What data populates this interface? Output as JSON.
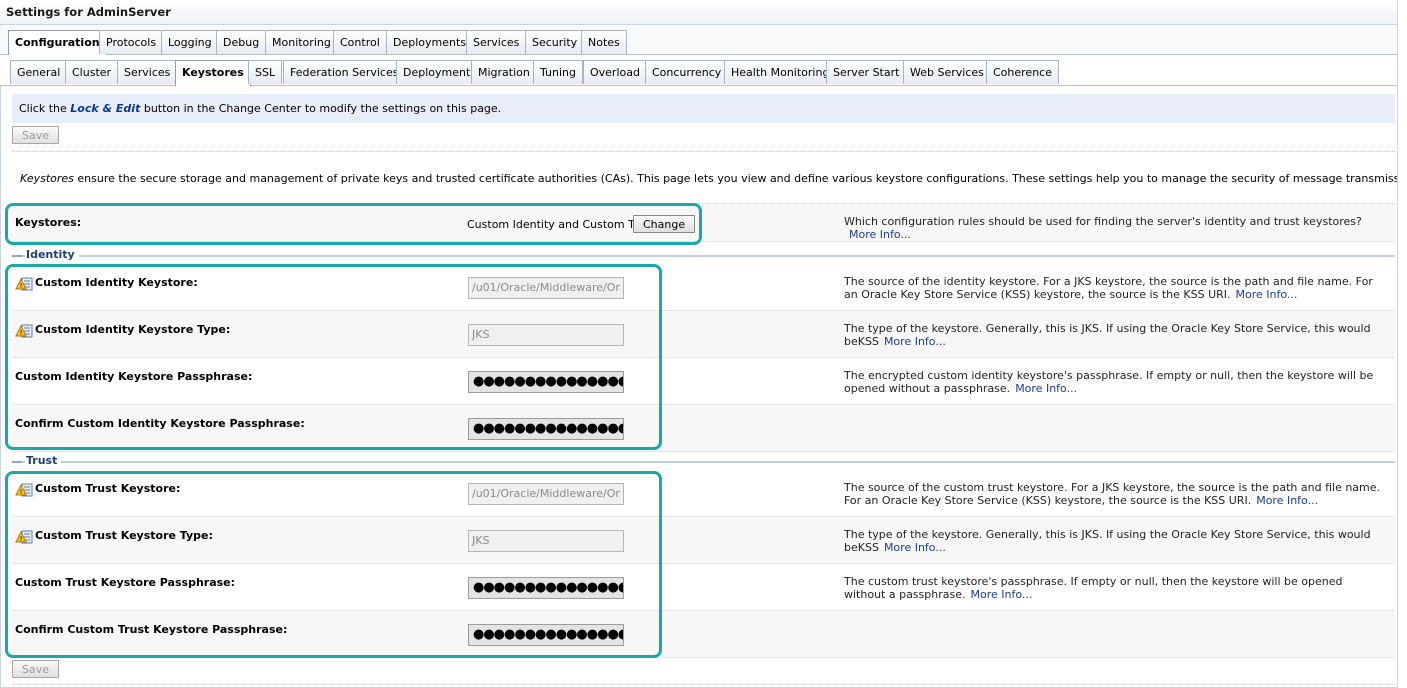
{
  "window": {
    "title": "Settings for AdminServer"
  },
  "primary_tabs": [
    {
      "label": "Configuration",
      "active": true
    },
    {
      "label": "Protocols"
    },
    {
      "label": "Logging"
    },
    {
      "label": "Debug"
    },
    {
      "label": "Monitoring"
    },
    {
      "label": "Control"
    },
    {
      "label": "Deployments"
    },
    {
      "label": "Services"
    },
    {
      "label": "Security"
    },
    {
      "label": "Notes"
    }
  ],
  "secondary_tabs": [
    {
      "label": "General"
    },
    {
      "label": "Cluster"
    },
    {
      "label": "Services"
    },
    {
      "label": "Keystores",
      "active": true
    },
    {
      "label": "SSL"
    },
    {
      "label": "Federation Services"
    },
    {
      "label": "Deployment"
    },
    {
      "label": "Migration"
    },
    {
      "label": "Tuning"
    },
    {
      "label": "Overload"
    },
    {
      "label": "Concurrency"
    },
    {
      "label": "Health Monitoring"
    },
    {
      "label": "Server Start"
    },
    {
      "label": "Web Services"
    },
    {
      "label": "Coherence"
    }
  ],
  "info": {
    "prefix": "Click the ",
    "emphasis": "Lock & Edit",
    "suffix": " button in the Change Center to modify the settings on this page."
  },
  "save_label": "Save",
  "description": {
    "emphasis": "Keystores",
    "text": " ensure the secure storage and management of private keys and trusted certificate authorities (CAs). This page lets you view and define various keystore configurations. These settings help you to manage the security of message transmissions."
  },
  "keystores_row": {
    "label": "Keystores:",
    "value": "Custom Identity and Custom Trust",
    "change_label": "Change",
    "help": "Which configuration rules should be used for finding the server's identity and trust keystores?",
    "more_info": "More Info..."
  },
  "identity": {
    "title": "Identity",
    "rows": [
      {
        "label": "Custom Identity Keystore:",
        "value": "/u01/Oracle/Middleware/Or",
        "help": "The source of the identity keystore. For a JKS keystore, the source is the path and file name. For an Oracle Key Store Service (KSS) keystore, the source is the KSS URI.",
        "more_info": "More Info..."
      },
      {
        "label": "Custom Identity Keystore Type:",
        "value": "JKS",
        "help": "The type of the keystore. Generally, this is JKS. If using the Oracle Key Store Service, this would beKSS",
        "more_info": "More Info..."
      },
      {
        "label": "Custom Identity Keystore Passphrase:",
        "value": "●●●●●●●●●●●●●●●●●●●",
        "help": "The encrypted custom identity keystore's passphrase. If empty or null, then the keystore will be opened without a passphrase.",
        "more_info": "More Info..."
      },
      {
        "label": "Confirm Custom Identity Keystore Passphrase:",
        "value": "●●●●●●●●●●●●●●●●●●●"
      }
    ]
  },
  "trust": {
    "title": "Trust",
    "rows": [
      {
        "label": "Custom Trust Keystore:",
        "value": "/u01/Oracle/Middleware/Or",
        "help": "The source of the custom trust keystore. For a JKS keystore, the source is the path and file name. For an Oracle Key Store Service (KSS) keystore, the source is the KSS URI.",
        "more_info": "More Info..."
      },
      {
        "label": "Custom Trust Keystore Type:",
        "value": "JKS",
        "help": "The type of the keystore. Generally, this is JKS. If using the Oracle Key Store Service, this would beKSS",
        "more_info": "More Info..."
      },
      {
        "label": "Custom Trust Keystore Passphrase:",
        "value": "●●●●●●●●●●●●●●●●●●●",
        "help": "The custom trust keystore's passphrase. If empty or null, then the keystore will be opened without a passphrase.",
        "more_info": "More Info..."
      },
      {
        "label": "Confirm Custom Trust Keystore Passphrase:",
        "value": "●●●●●●●●●●●●●●●●●●●"
      }
    ]
  },
  "colors": {
    "highlight": "#1aa8a8",
    "link": "#1a3d9c",
    "info_bg": "#e7eefa"
  }
}
